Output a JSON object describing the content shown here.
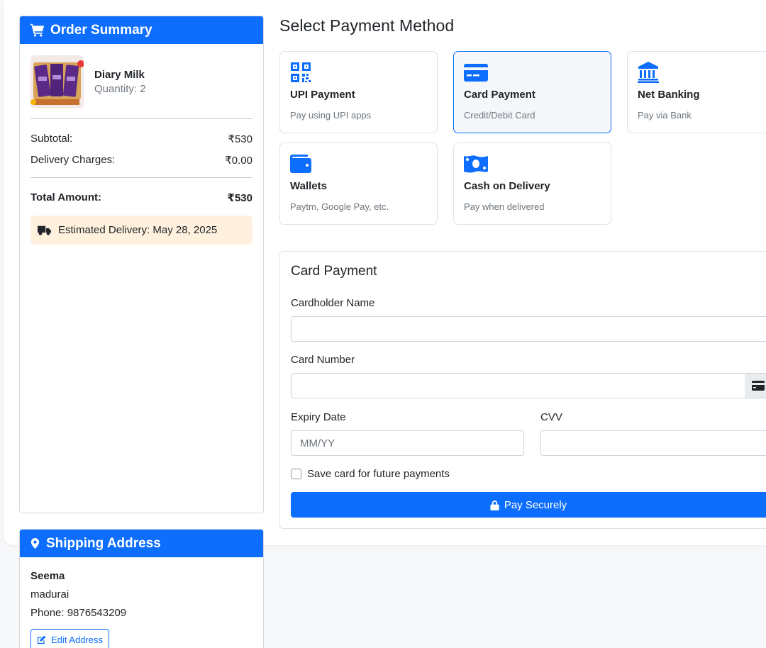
{
  "order_summary": {
    "title": "Order Summary",
    "product": {
      "name": "Diary Milk",
      "quantity": "Quantity: 2"
    },
    "subtotal_label": "Subtotal:",
    "subtotal_value": "₹530",
    "delivery_label": "Delivery Charges:",
    "delivery_value": "₹0.00",
    "total_label": "Total Amount:",
    "total_value": "₹530",
    "estimated_delivery": "Estimated Delivery: May 28, 2025"
  },
  "shipping": {
    "title": "Shipping Address",
    "name": "Seema",
    "city": "madurai",
    "phone": "Phone: 9876543209",
    "edit_label": "Edit Address"
  },
  "payment": {
    "title": "Select Payment Method",
    "methods": [
      {
        "title": "UPI Payment",
        "subtitle": "Pay using UPI apps",
        "icon": "qr-code-icon"
      },
      {
        "title": "Card Payment",
        "subtitle": "Credit/Debit Card",
        "icon": "credit-card-icon",
        "selected": true
      },
      {
        "title": "Net Banking",
        "subtitle": "Pay via Bank",
        "icon": "bank-icon"
      },
      {
        "title": "Wallets",
        "subtitle": "Paytm, Google Pay, etc.",
        "icon": "wallet-icon"
      },
      {
        "title": "Cash on Delivery",
        "subtitle": "Pay when delivered",
        "icon": "cash-icon"
      }
    ]
  },
  "card_form": {
    "title": "Card Payment",
    "cardholder_label": "Cardholder Name",
    "cardholder_value": "",
    "card_number_label": "Card Number",
    "card_number_value": "",
    "expiry_label": "Expiry Date",
    "expiry_placeholder": "MM/YY",
    "cvv_label": "CVV",
    "cvv_value": "",
    "save_card_label": "Save card for future payments",
    "save_card_checked": false,
    "pay_label": "Pay Securely"
  },
  "colors": {
    "primary": "#0d6efd",
    "delivery_bg": "#fff1dd",
    "muted": "#6c757d"
  }
}
